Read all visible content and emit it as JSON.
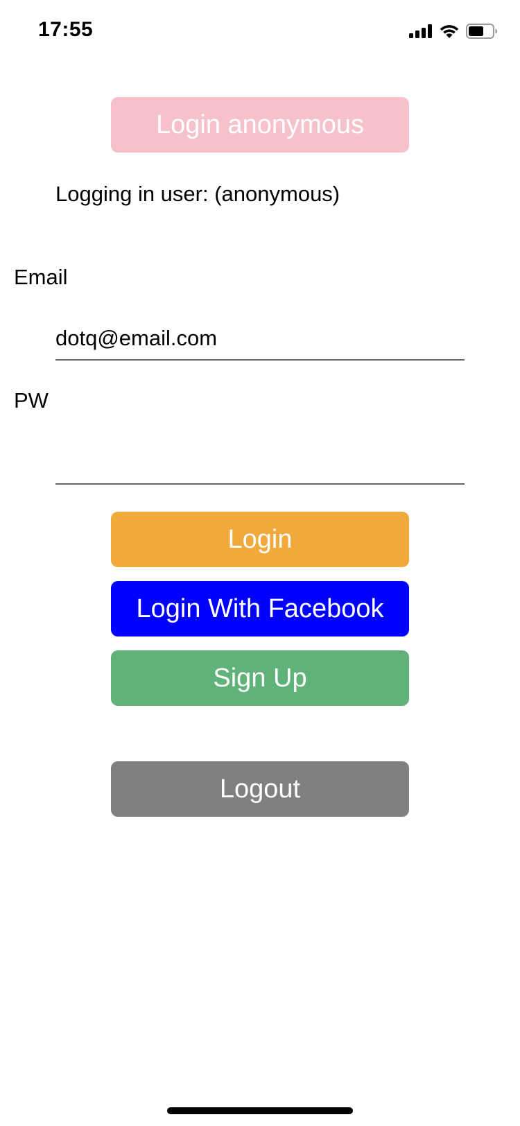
{
  "status_bar": {
    "time": "17:55",
    "icons": [
      "cellular-signal-icon",
      "wifi-icon",
      "battery-icon"
    ]
  },
  "buttons": {
    "login_anonymous": "Login anonymous",
    "login": "Login",
    "login_facebook": "Login With Facebook",
    "sign_up": "Sign Up",
    "logout": "Logout"
  },
  "status_message": "Logging in user: (anonymous)",
  "form": {
    "email_label": "Email",
    "email_value": "dotq@email.com",
    "password_label": "PW",
    "password_value": ""
  },
  "colors": {
    "login_anonymous": "#f5c1cb",
    "login": "#f0a93b",
    "login_facebook": "#0000ff",
    "sign_up": "#60b27a",
    "logout": "#808080"
  }
}
